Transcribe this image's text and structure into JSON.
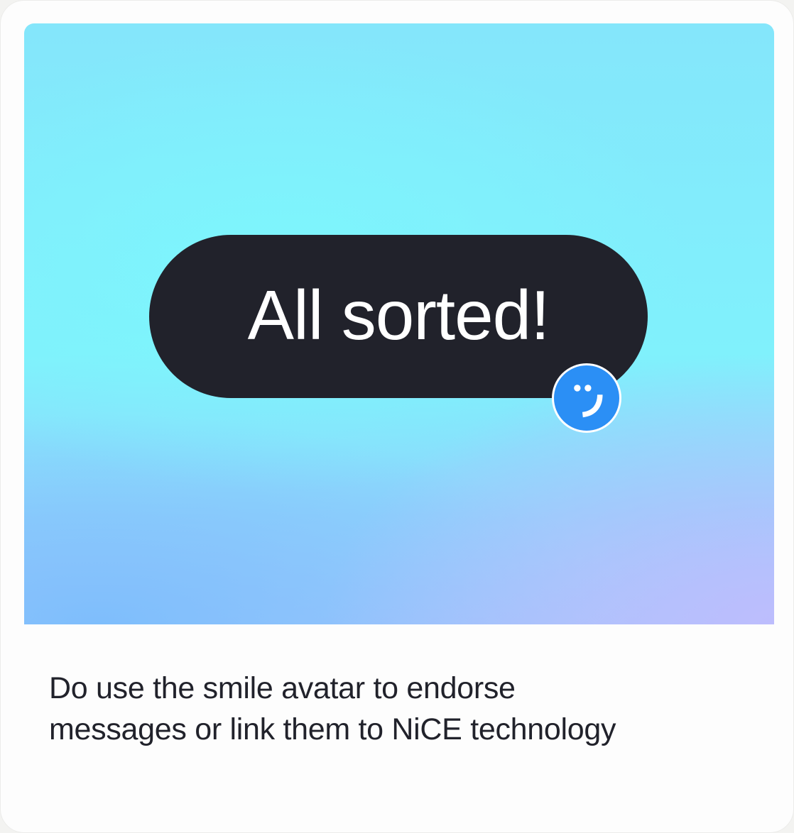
{
  "hero": {
    "bubble_text": "All sorted!",
    "avatar_icon": "smile-icon",
    "colors": {
      "bubble": "#21222b",
      "avatar": "#2b8ff5",
      "gradient_cyan": "#80f1fc",
      "gradient_blue": "#7ebefc",
      "gradient_violet": "#bdbdfd"
    }
  },
  "caption": {
    "line1": "Do use the smile avatar to endorse",
    "line2": "messages or link them to NiCE technology"
  }
}
